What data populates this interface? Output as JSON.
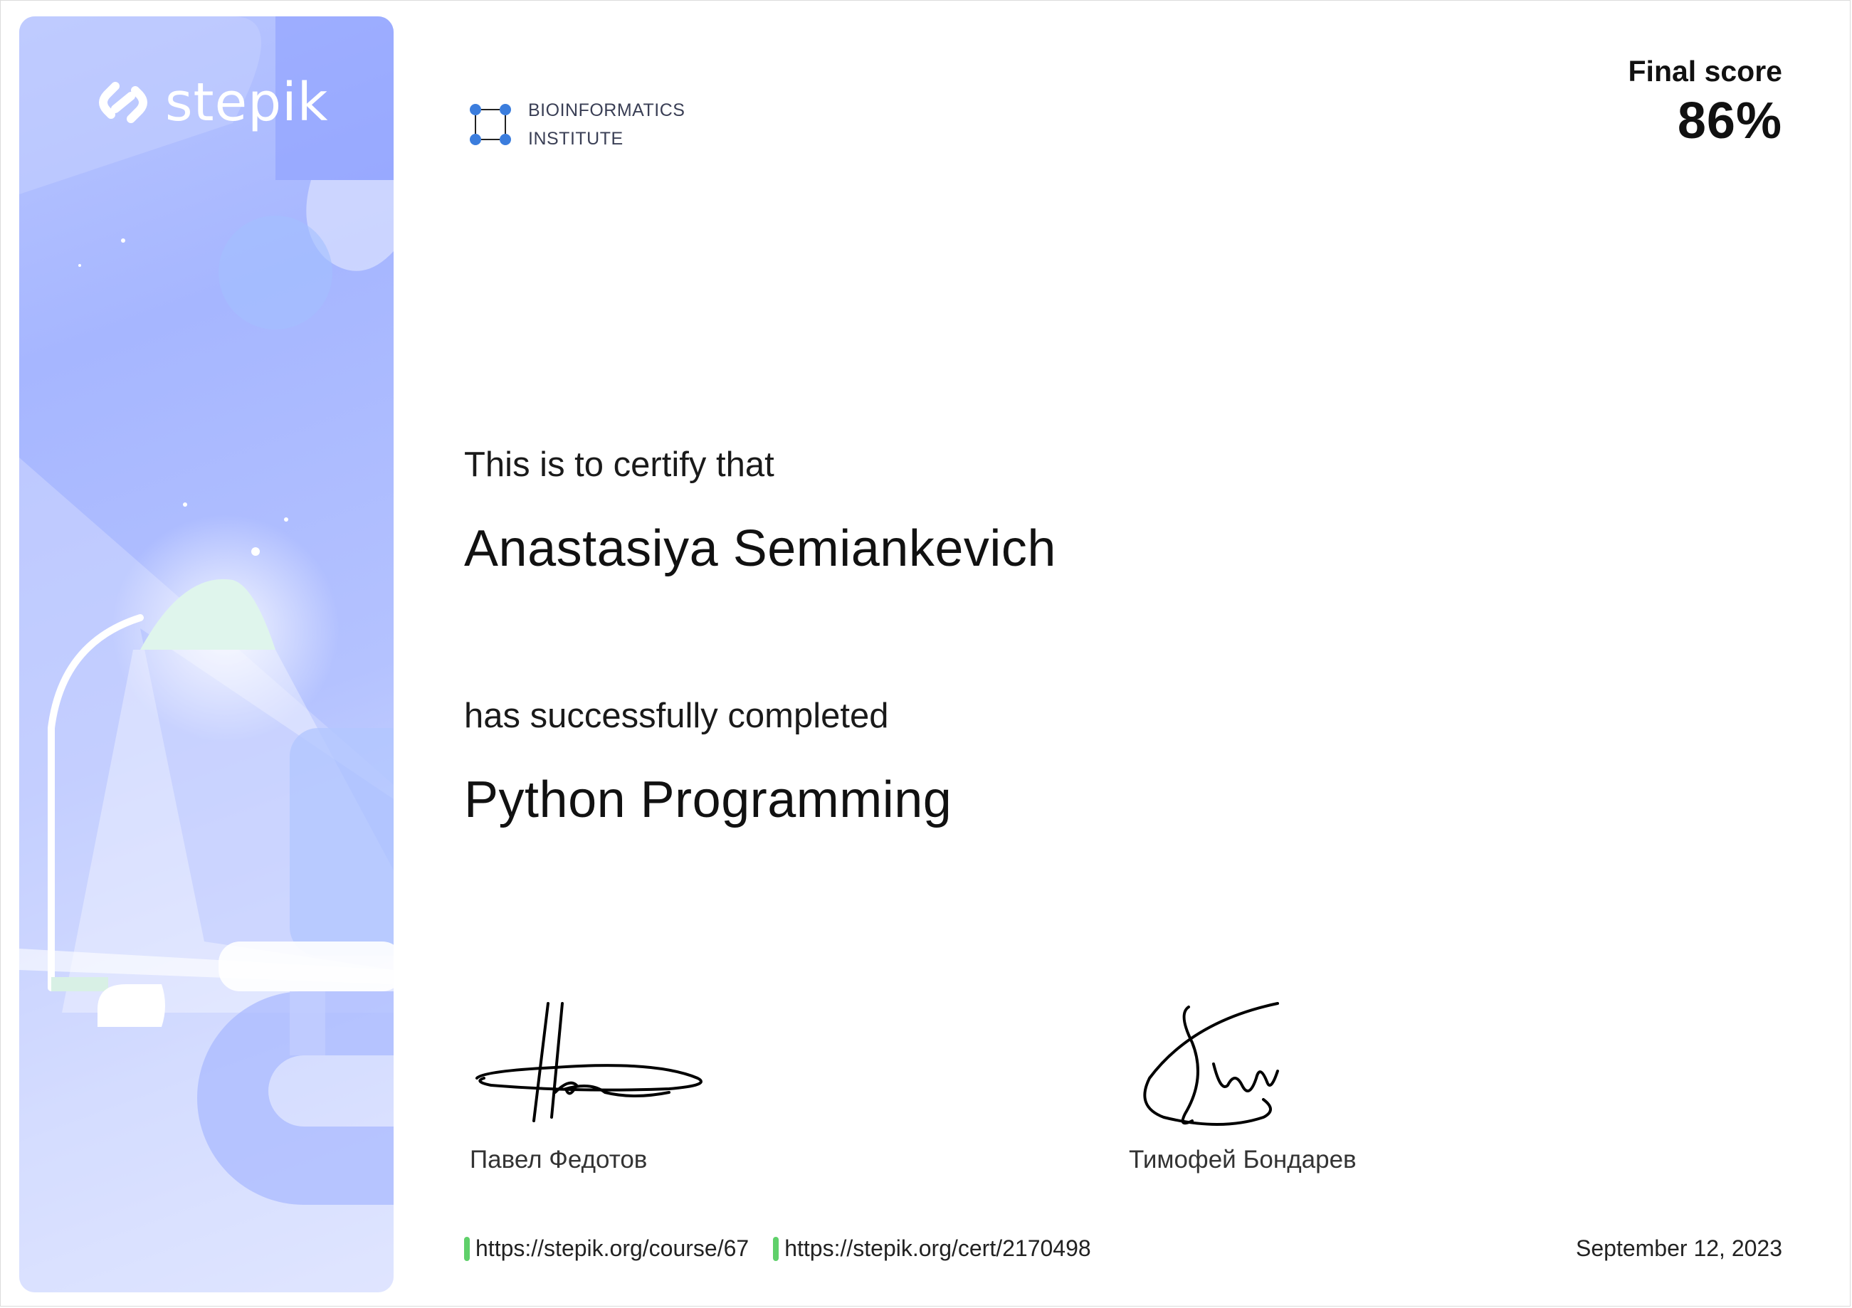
{
  "brand": {
    "name": "stepik",
    "logo_icon": "stepik-logo-icon"
  },
  "institute": {
    "line1": "BIOINFORMATICS",
    "line2": "INSTITUTE",
    "logo_icon": "bioinformatics-institute-logo-icon",
    "logo_color": "#3b7ddd"
  },
  "score": {
    "label": "Final score",
    "value": "86%"
  },
  "certificate": {
    "intro": "This is to certify that",
    "recipient": "Anastasiya Semiankevich",
    "completed_text": "has successfully completed",
    "course": "Python Programming"
  },
  "signatures": [
    {
      "name": "Павел Федотов"
    },
    {
      "name": "Тимофей Бондарев"
    }
  ],
  "footer": {
    "course_url": "https://stepik.org/course/67",
    "cert_url": "https://stepik.org/cert/2170498",
    "date": "September 12, 2023",
    "link_marker_color": "#5fd06a"
  },
  "colors": {
    "panel_accent": "#a6b6ff",
    "text": "#111111"
  }
}
